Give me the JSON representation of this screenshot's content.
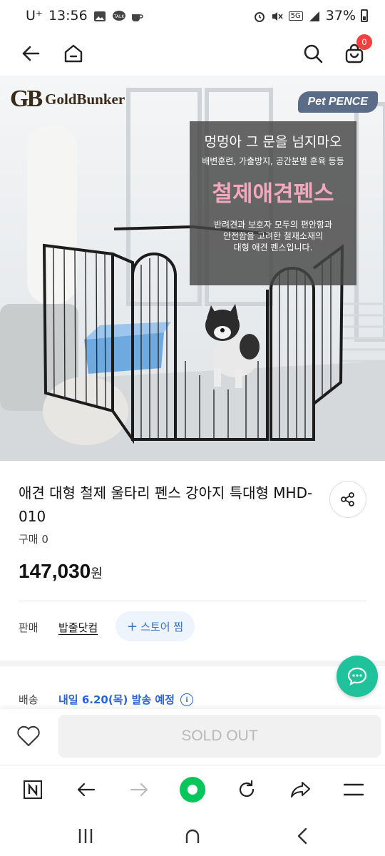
{
  "status_bar": {
    "carrier": "U⁺",
    "time": "13:56",
    "battery": "37%",
    "network": "5G"
  },
  "header": {
    "cart_count": "0"
  },
  "hero": {
    "brand_mark": "GB",
    "brand_name": "GoldBunker",
    "tag": "Pet PENCE",
    "headline": "멍멍아 그 문을 넘지마오",
    "subline": "배변훈련, 가출방지, 공간분별 훈육 등등",
    "product_name": "철제애견펜스",
    "description_1": "반려견과 보호자 모두의 편안함과",
    "description_2": "안전함을 고려한 철재소재의",
    "description_3": "대형 애견 펜스입니다."
  },
  "product": {
    "title": "애견 대형 철제 울타리 펜스 강아지 특대형 MHD-010",
    "purchase_count": "구매 0",
    "price": "147,030",
    "currency": "원"
  },
  "seller": {
    "label": "판매",
    "name": "밥줄닷컴",
    "follow_label": "스토어 찜"
  },
  "shipping": {
    "label": "배송",
    "date": "내일 6.20(목) 발송 예정"
  },
  "buy_bar": {
    "soldout_label": "SOLD OUT"
  },
  "colors": {
    "accent_blue": "#2a64d8",
    "chat_green": "#1fc29a",
    "naver_green": "#03c75a",
    "badge_red": "#f04040"
  }
}
